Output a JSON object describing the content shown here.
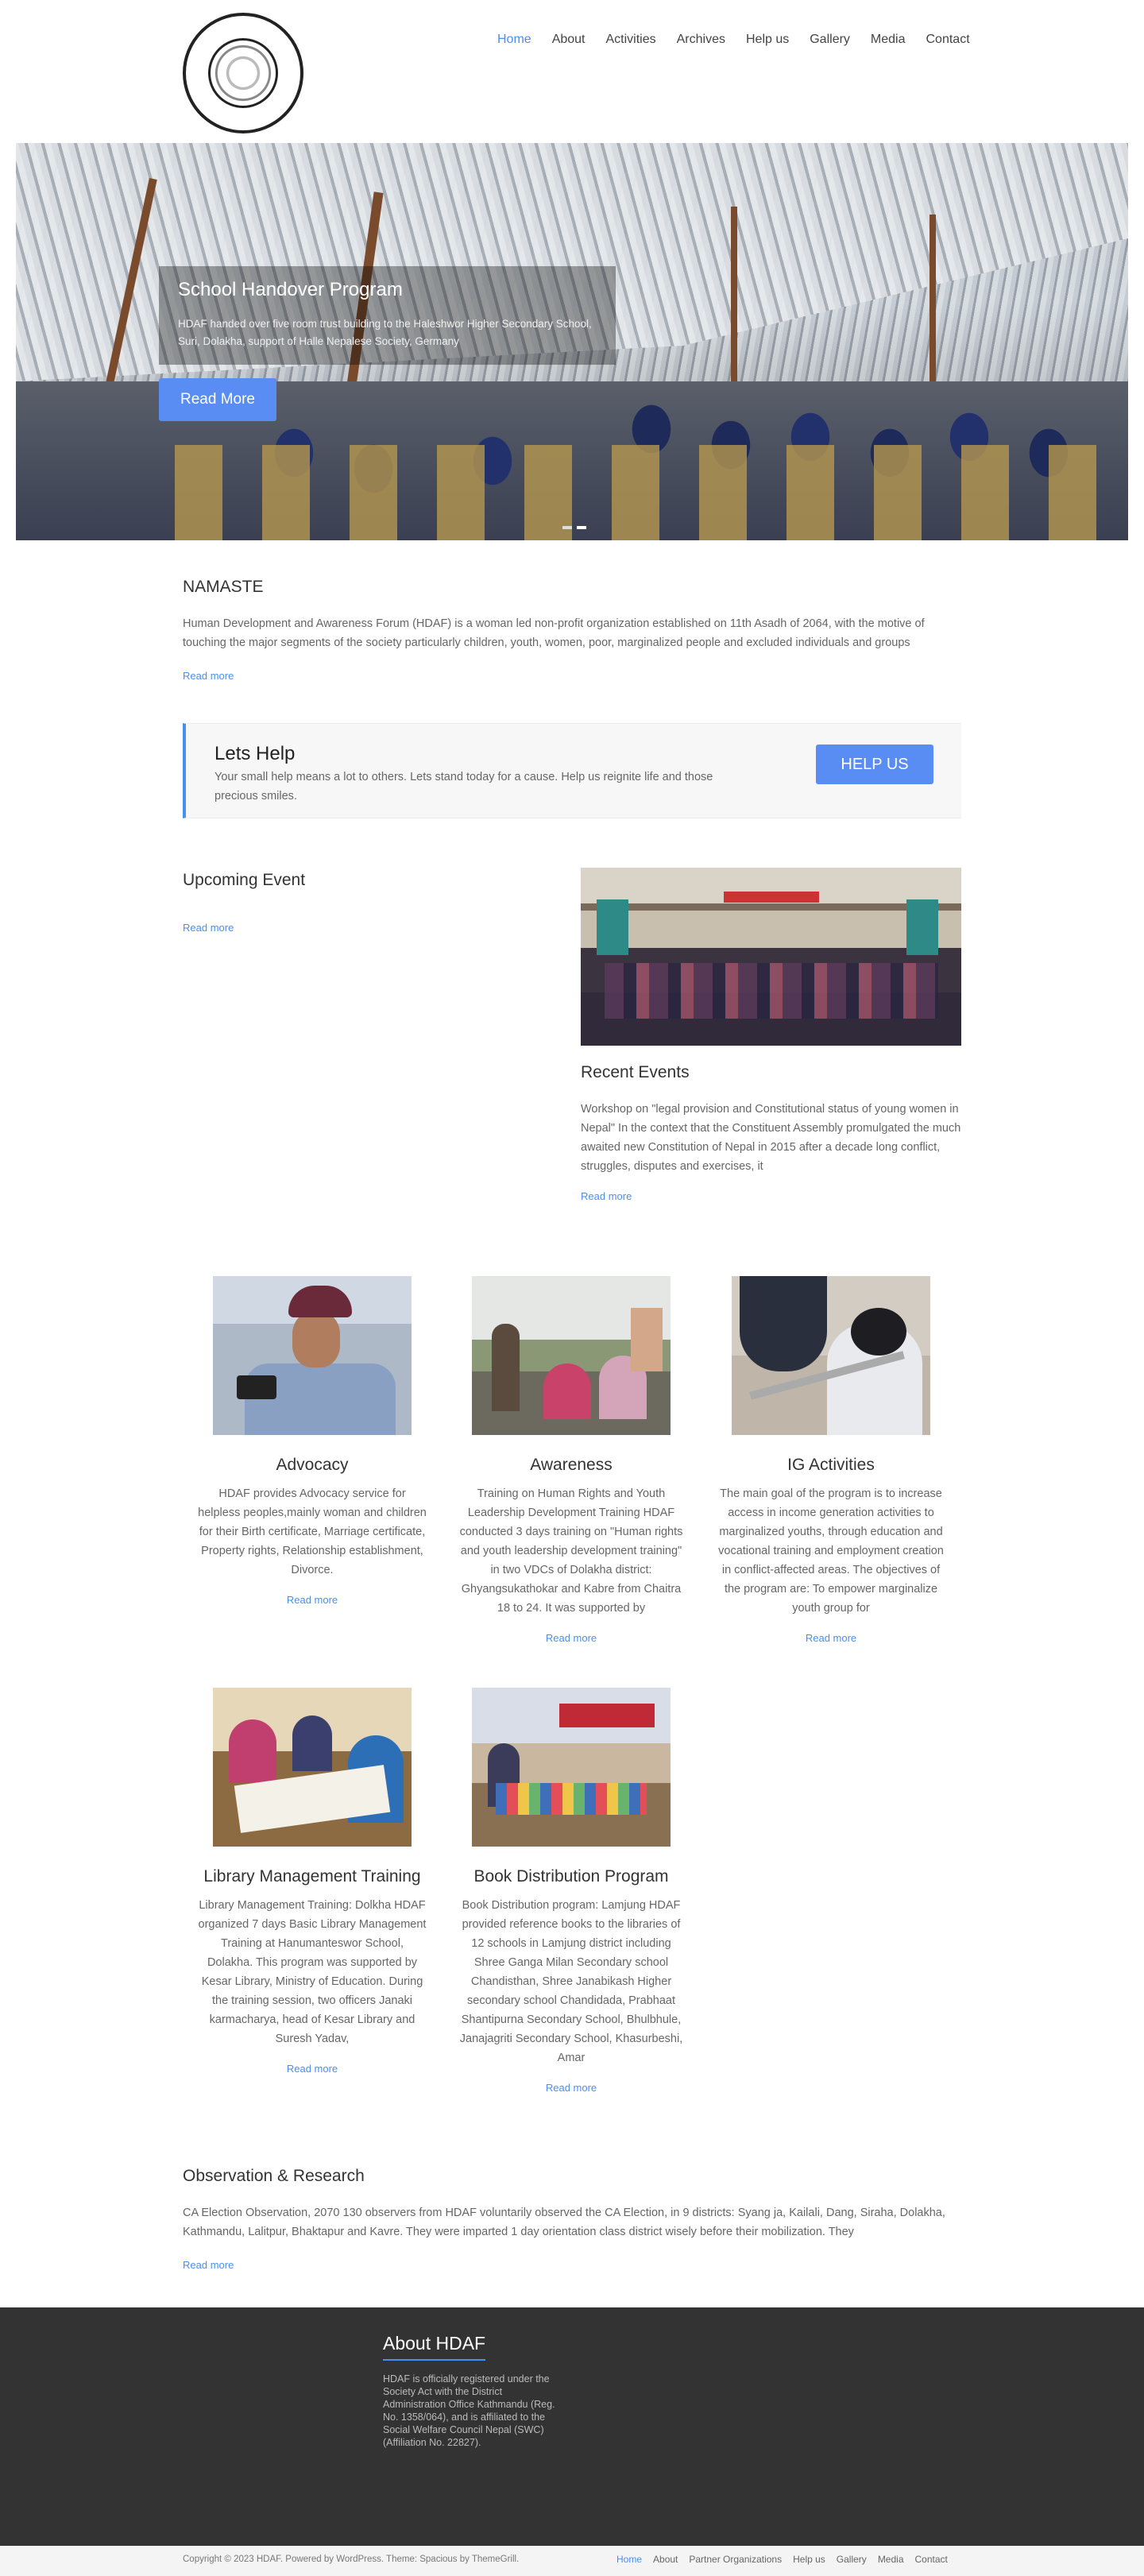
{
  "header": {
    "logo_alt": "Human Development & Awareness Forum logo",
    "nav": [
      {
        "label": "Home",
        "active": true
      },
      {
        "label": "About"
      },
      {
        "label": "Activities"
      },
      {
        "label": "Archives"
      },
      {
        "label": "Help us"
      },
      {
        "label": "Gallery"
      },
      {
        "label": "Media"
      },
      {
        "label": "Contact"
      }
    ]
  },
  "hero": {
    "title": "School Handover Program",
    "text": "HDAF handed over five room trust building to the Haleshwor Higher Secondary School, Suri, Dolakha, support of Halle Nepalese Society, Germany",
    "button": "Read More"
  },
  "namaste": {
    "title": "NAMASTE",
    "text": "Human Development and Awareness Forum (HDAF) is a woman led non-profit organization established on 11th Asadh of 2064, with the motive of touching the major segments of the society particularly children, youth, women, poor, marginalized people and excluded individuals and groups",
    "readmore": "Read more"
  },
  "cta": {
    "title": "Lets Help",
    "text": "Your small help means a lot to others. Lets stand today for a cause. Help us reignite life and those precious smiles.",
    "button": "HELP US"
  },
  "upcoming": {
    "title": "Upcoming Event",
    "readmore": "Read more"
  },
  "recent": {
    "title": "Recent Events",
    "text": "Workshop on \"legal provision and Constitutional status of young women in Nepal\" In the context that the Constituent Assembly promulgated the much awaited new Constitution of Nepal in 2015 after a decade long conflict, struggles, disputes and exercises, it",
    "readmore": "Read more"
  },
  "cards": {
    "advocacy": {
      "title": "Advocacy",
      "text": "HDAF provides Advocacy service for helpless peoples,mainly woman and children for their Birth certificate, Marriage certificate, Property rights, Relationship establishment, Divorce.",
      "readmore": "Read more"
    },
    "awareness": {
      "title": "Awareness",
      "text": "Training on Human Rights and Youth Leadership Development Training HDAF conducted 3 days training on \"Human rights and youth leadership development training\" in two VDCs of Dolakha district: Ghyangsukathokar and Kabre from Chaitra 18 to 24. It was supported by",
      "readmore": "Read more"
    },
    "ig": {
      "title": "IG Activities",
      "text": "The main goal of the program is to increase access in income generation activities to marginalized youths, through education and vocational training and employment creation in conflict-affected areas. The objectives of the program are: To empower marginalize youth group for",
      "readmore": "Read more"
    },
    "library": {
      "title": "Library Management Training",
      "text": "Library Management Training: Dolkha HDAF organized 7 days Basic Library Management Training at Hanumanteswor School, Dolakha. This program was supported by Kesar Library, Ministry of Education. During the training session, two officers Janaki karmacharya, head of Kesar Library and Suresh Yadav,",
      "readmore": "Read more"
    },
    "books": {
      "title": "Book Distribution Program",
      "text": "Book Distribution program: Lamjung HDAF provided reference books to the libraries of 12 schools in Lamjung district including Shree Ganga Milan Secondary school Chandisthan, Shree Janabikash Higher secondary school Chandidada, Prabhaat Shantipurna Secondary School, Bhulbhule, Janajagriti Secondary School, Khasurbeshi, Amar",
      "readmore": "Read more"
    }
  },
  "observation": {
    "title": "Observation & Research",
    "text": "CA Election Observation, 2070 130 observers from HDAF voluntarily observed the CA Election, in 9 districts: Syang ja, Kailali, Dang, Siraha, Dolakha, Kathmandu, Lalitpur, Bhaktapur and Kavre. They were imparted 1 day orientation class district wisely before their mobilization. They",
    "readmore": "Read more"
  },
  "footer": {
    "title": "About HDAF",
    "text": "HDAF is officially registered under the Society Act with the District Administration Office Kathmandu (Reg. No. 1358/064), and is affiliated to the Social Welfare Council Nepal (SWC) (Affiliation No. 22827).",
    "copyright": "Copyright © 2023 HDAF. Powered by WordPress. Theme: Spacious by ThemeGrill.",
    "nav": [
      {
        "label": "Home",
        "active": true
      },
      {
        "label": "About"
      },
      {
        "label": "Partner Organizations"
      },
      {
        "label": "Help us"
      },
      {
        "label": "Gallery"
      },
      {
        "label": "Media"
      },
      {
        "label": "Contact"
      }
    ]
  },
  "colors": {
    "accent": "#4a8ef0",
    "button": "#5a8df3",
    "footer_bg": "#333333"
  }
}
